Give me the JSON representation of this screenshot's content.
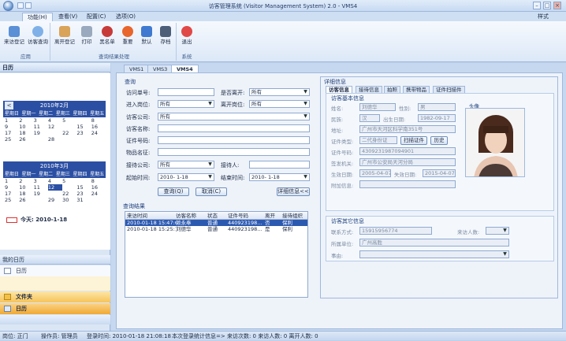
{
  "window": {
    "title": "访客管理系统 (Visitor Management System) 2.0 - VMS4"
  },
  "ribbon": {
    "tabs": [
      "功能(H)",
      "查看(V)",
      "配置(C)",
      "选项(O)"
    ],
    "style_label": "样式",
    "groups": [
      {
        "label": "应用",
        "buttons": [
          {
            "label": "来访登记",
            "icon": "register-icon"
          },
          {
            "label": "访客查询",
            "icon": "search-icon"
          }
        ]
      },
      {
        "label": "查询结果处理",
        "buttons": [
          {
            "label": "离开登记",
            "icon": "leave-icon"
          },
          {
            "label": "打印",
            "icon": "print-icon"
          },
          {
            "label": "黑名单",
            "icon": "blacklist-icon"
          },
          {
            "label": "重要",
            "icon": "important-icon"
          },
          {
            "label": "默认",
            "icon": "default-icon"
          },
          {
            "label": "存档",
            "icon": "archive-icon"
          }
        ]
      },
      {
        "label": "系统",
        "buttons": [
          {
            "label": "退出",
            "icon": "exit-icon"
          }
        ]
      }
    ]
  },
  "left": {
    "calendar_title": "日历",
    "weekdays": [
      "星期日",
      "星期一",
      "星期二",
      "星期三",
      "星期四",
      "星期五"
    ],
    "cal1": {
      "month": "2010年2月",
      "days": [
        "1",
        "2",
        "3",
        "4",
        "5",
        "",
        "8",
        "9",
        "10",
        "11",
        "12",
        "",
        "15",
        "16",
        "17",
        "18",
        "19",
        "",
        "22",
        "23",
        "24",
        "25",
        "26",
        "",
        "28",
        "",
        "",
        "",
        "",
        "",
        ""
      ]
    },
    "cal2": {
      "month": "2010年3月",
      "days": [
        "1",
        "2",
        "3",
        "4",
        "5",
        "",
        "8",
        "9",
        "10",
        "11",
        "12",
        "",
        "15",
        "16",
        "17",
        "18",
        "19",
        "",
        "22",
        "23",
        "24",
        "25",
        "26",
        "",
        "29",
        "30",
        "31",
        "",
        "",
        ""
      ],
      "selected": "12"
    },
    "today": "今天: 2010-1-18",
    "my_calendar": "我的日历",
    "calendar_item": "日历",
    "nav": [
      {
        "label": "文件夹"
      },
      {
        "label": "日历"
      }
    ]
  },
  "doc_tabs": [
    "VMS1",
    "VMS3",
    "VMS4"
  ],
  "query": {
    "title": "查询",
    "fields": {
      "visit_no": {
        "label": "访问单号:",
        "value": ""
      },
      "left": {
        "label": "是否离开:",
        "value": "所有"
      },
      "entry_post": {
        "label": "进入岗位:",
        "value": "所有"
      },
      "exit_post": {
        "label": "离开岗位:",
        "value": "所有"
      },
      "visitor_company": {
        "label": "访客公司:",
        "value": "所有"
      },
      "visitor_name": {
        "label": "访客名称:",
        "value": ""
      },
      "id_no": {
        "label": "证件号码:",
        "value": ""
      },
      "item_name": {
        "label": "物品名征:",
        "value": ""
      },
      "host_company": {
        "label": "接待公司:",
        "value": "所有"
      },
      "host": {
        "label": "接待人:",
        "value": ""
      },
      "start_time": {
        "label": "起始时间:",
        "value": "2010- 1-18"
      },
      "end_time": {
        "label": "结束时间:",
        "value": "2010- 1-18"
      }
    },
    "buttons": {
      "query": "查询(Q)",
      "cancel": "取消(C)",
      "detail": "详细信息<<"
    }
  },
  "results": {
    "title": "查询结果",
    "columns": [
      "来访时间",
      "访客名称",
      "状态",
      "证件号码",
      "离开",
      "接待组织"
    ],
    "rows": [
      [
        "2010-01-18 15:47:09",
        "赖永奉",
        "普通",
        "440923198...",
        "否",
        "保利"
      ],
      [
        "2010-01-18 15:25:11",
        "刘德华",
        "普通",
        "440923198...",
        "是",
        "保利"
      ]
    ]
  },
  "detail": {
    "title": "详细信息",
    "tabs": [
      "访客信息",
      "接待信息",
      "拍照",
      "携带物品",
      "证件扫描件"
    ],
    "basic_title": "访客基本信息",
    "photo_label": "头像",
    "fields": [
      {
        "label": "姓名:",
        "value": "刘德华"
      },
      {
        "label": "性别:",
        "value": "男"
      },
      {
        "label": "民族:",
        "value": "汉"
      },
      {
        "label": "出生日期:",
        "value": "1982-09-17"
      },
      {
        "label": "地址:",
        "value": "广州市天河区科学南351号"
      },
      {
        "label": "证件类型:",
        "value": "二代身份证"
      },
      {
        "label": "证件号码:",
        "value": "4309231987094901"
      },
      {
        "label": "签发机关:",
        "value": "广州市公安局天河分局"
      },
      {
        "label": "生效日期:",
        "value": "2005-04-07"
      },
      {
        "label": "失效日期:",
        "value": "2015-04-07"
      },
      {
        "label": "附加信息:",
        "value": ""
      }
    ],
    "scan_button": "扫描证件",
    "history_button": "历史",
    "other_title": "访客其它信息",
    "contact": {
      "label": "联系方式:",
      "value": "15915956774"
    },
    "visitors": {
      "label": "来访人数:",
      "value": ""
    },
    "company": {
      "label": "所属单位:",
      "value": "广州高胜"
    },
    "reason": {
      "label": "事由:",
      "value": ""
    }
  },
  "status": {
    "post": "岗位: 正门",
    "operator": "操作员: 管理员",
    "login": "登录时间: 2010-01-18 21:08:18",
    "stats": "本次登录统计信息=> 来访次数: 0 来访人数: 0 离开人数: 0"
  }
}
